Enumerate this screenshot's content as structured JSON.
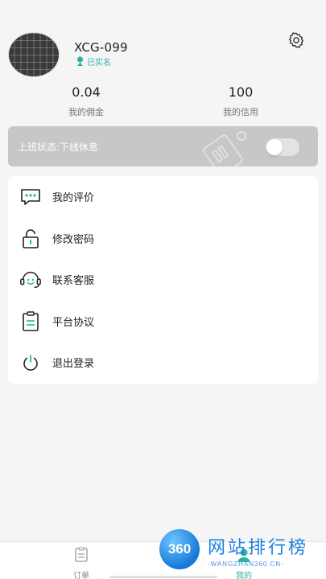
{
  "profile": {
    "username": "XCG-099",
    "verified_label": "已实名"
  },
  "stats": {
    "commission_value": "0.04",
    "commission_label": "我的佣金",
    "credit_value": "100",
    "credit_label": "我的信用"
  },
  "work_status": {
    "label": "上班状态:下线休息",
    "toggle_on": false
  },
  "menu": {
    "items": [
      {
        "label": "我的评价",
        "icon": "chat-bubble-icon"
      },
      {
        "label": "修改密码",
        "icon": "lock-icon"
      },
      {
        "label": "联系客服",
        "icon": "headset-icon"
      },
      {
        "label": "平台协议",
        "icon": "clipboard-icon"
      },
      {
        "label": "退出登录",
        "icon": "power-icon"
      }
    ]
  },
  "tabbar": {
    "orders_label": "订单",
    "mine_label": "我的"
  },
  "watermark": {
    "logo_text": "360",
    "title": "网站排行榜",
    "url": "-WANGZHAN360.CN-"
  },
  "colors": {
    "accent": "#2bb3a7",
    "status_bar": "#c7c7c7",
    "background": "#f5f5f5"
  }
}
